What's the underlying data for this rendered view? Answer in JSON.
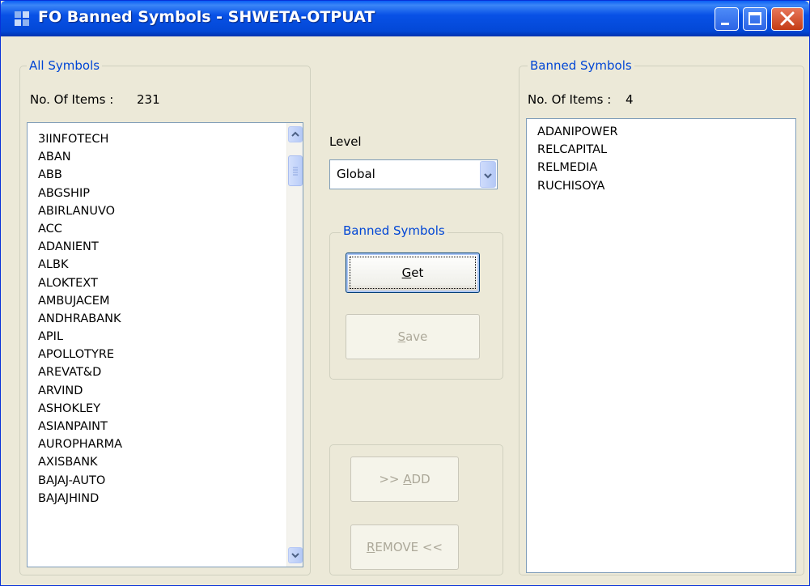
{
  "window": {
    "title": "FO Banned Symbols - SHWETA-OTPUAT"
  },
  "all_symbols": {
    "group_label": "All Symbols",
    "count_label": "No. Of Items :",
    "count_value": "231",
    "items": [
      "3IINFOTECH",
      "ABAN",
      "ABB",
      "ABGSHIP",
      "ABIRLANUVO",
      "ACC",
      "ADANIENT",
      "ALBK",
      "ALOKTEXT",
      "AMBUJACEM",
      "ANDHRABANK",
      "APIL",
      "APOLLOTYRE",
      "AREVAT&D",
      "ARVIND",
      "ASHOKLEY",
      "ASIANPAINT",
      "AUROPHARMA",
      "AXISBANK",
      "BAJAJ-AUTO",
      "BAJAJHIND"
    ]
  },
  "level": {
    "label": "Level",
    "selected": "Global"
  },
  "banned_actions": {
    "group_label": "Banned Symbols",
    "get": {
      "mnemonic": "G",
      "rest": "et"
    },
    "save": {
      "mnemonic": "S",
      "rest": "ave"
    }
  },
  "transfer": {
    "add": {
      "prefix": ">> ",
      "mnemonic": "A",
      "rest": "DD"
    },
    "remove": {
      "mnemonic": "R",
      "rest": "EMOVE <<"
    }
  },
  "banned_symbols": {
    "group_label": "Banned Symbols",
    "count_label": "No. Of Items :",
    "count_value": "4",
    "items": [
      "ADANIPOWER",
      "RELCAPITAL",
      "RELMEDIA",
      "RUCHISOYA"
    ]
  },
  "colors": {
    "titlebar": "#0348d6",
    "group_label": "#0046d5",
    "window_bg": "#ece9d8",
    "disabled_text": "#aca899"
  }
}
